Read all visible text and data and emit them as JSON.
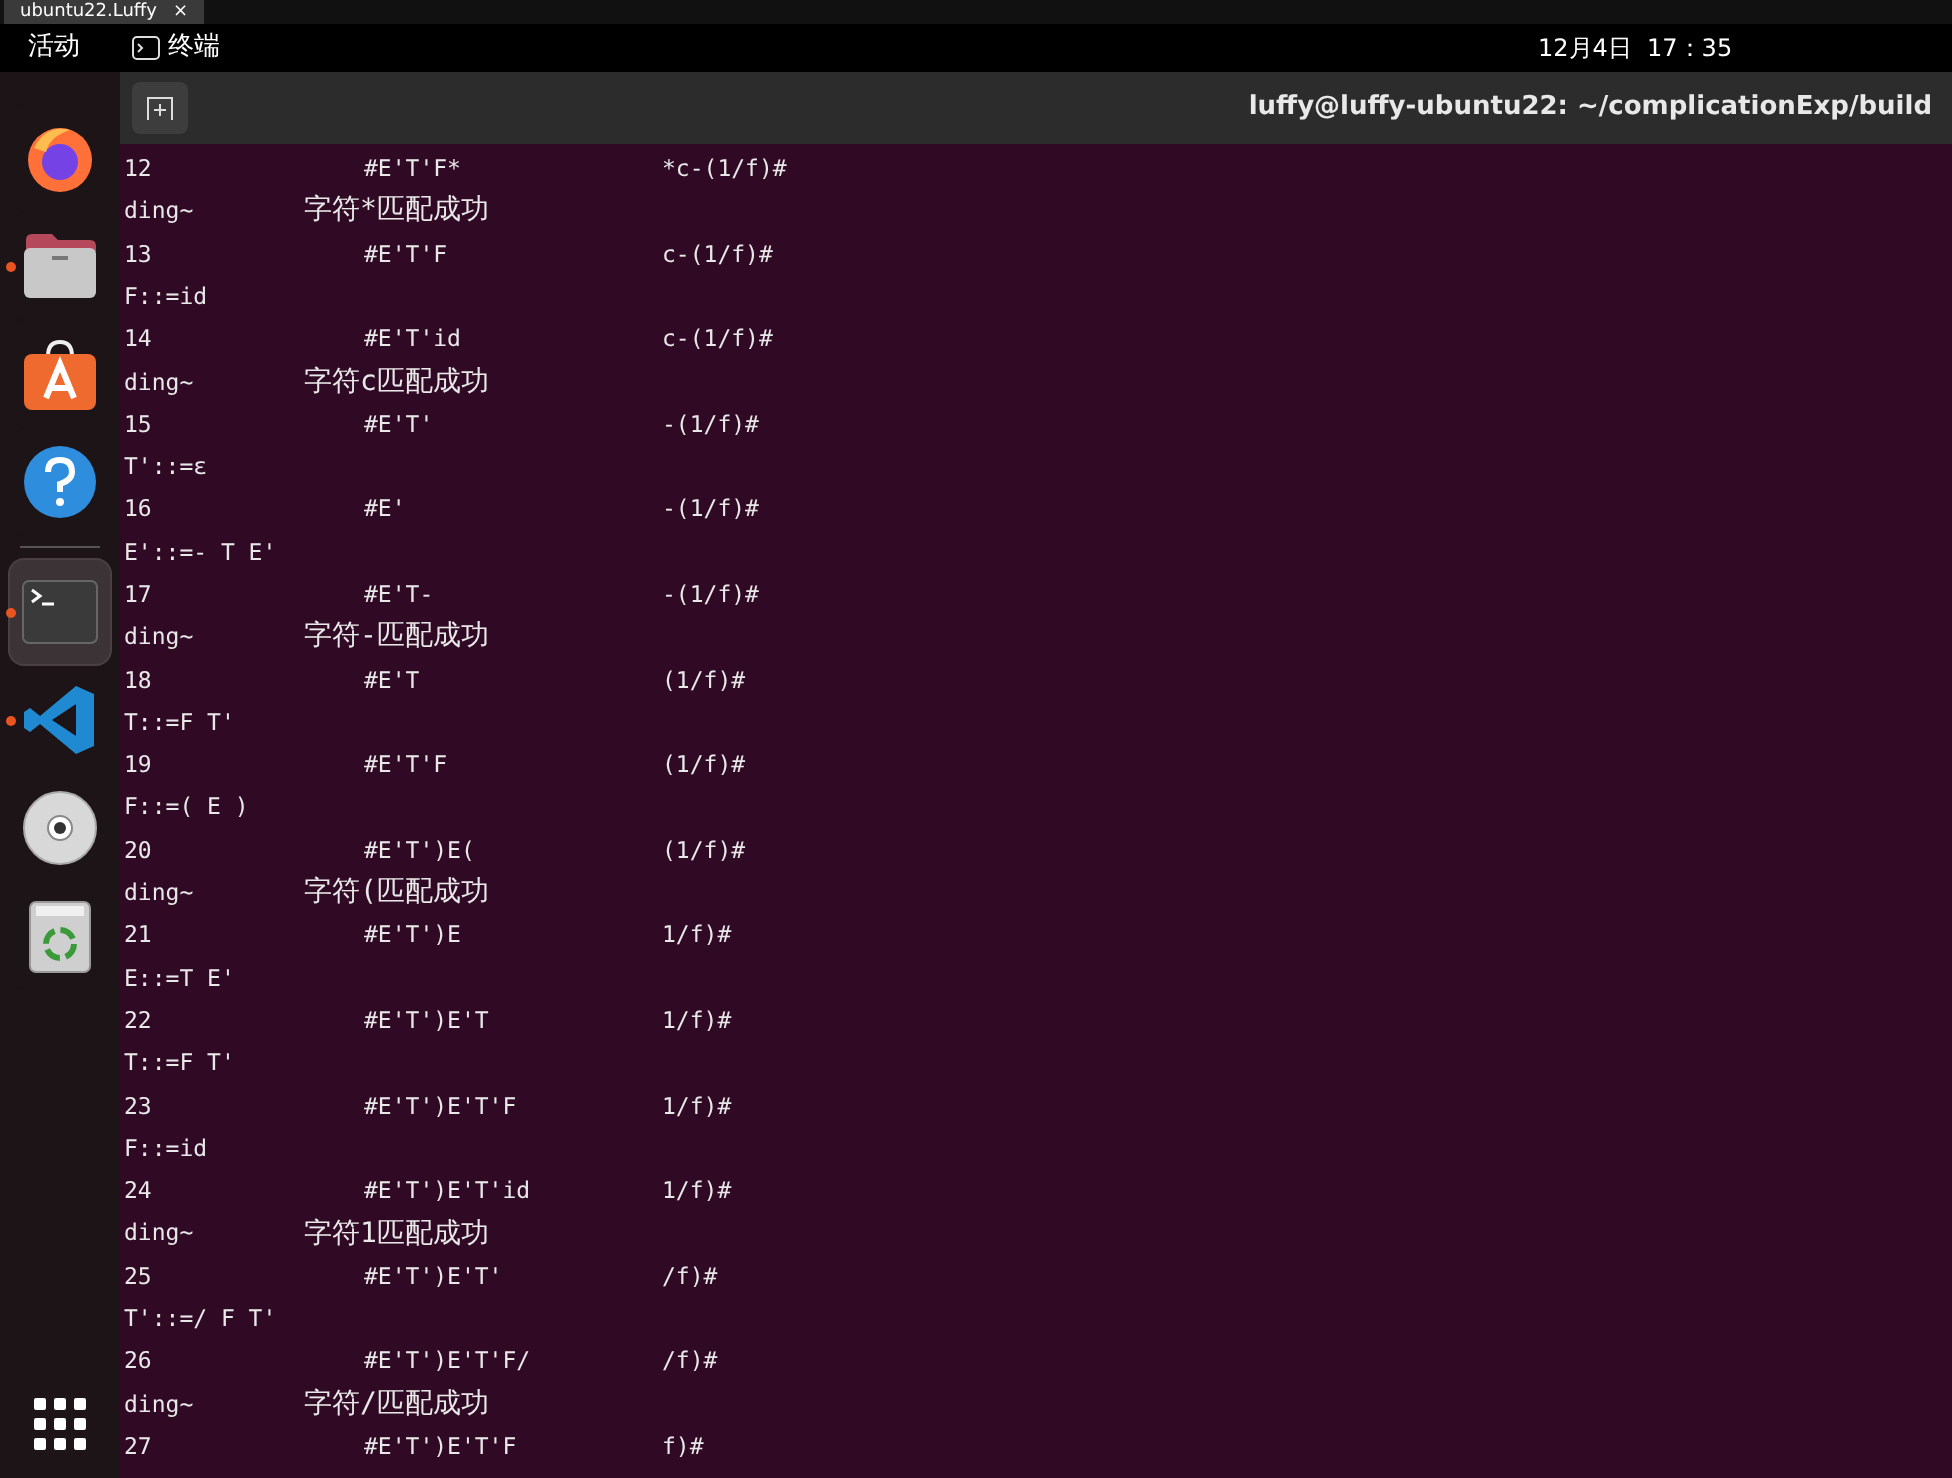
{
  "window_tab": {
    "title": "ubuntu22.Luffy",
    "close": "×"
  },
  "top_bar": {
    "activities": "活动",
    "app_name": "终端",
    "clock": "12月4日  17：35"
  },
  "dock": {
    "items": [
      {
        "kind": "firefox",
        "running": false,
        "selected": false
      },
      {
        "kind": "files",
        "running": true,
        "selected": false
      },
      {
        "kind": "store",
        "running": false,
        "selected": false
      },
      {
        "kind": "help",
        "running": false,
        "selected": false
      },
      {
        "kind": "separator"
      },
      {
        "kind": "terminal",
        "running": true,
        "selected": true
      },
      {
        "kind": "vscode",
        "running": true,
        "selected": false
      },
      {
        "kind": "disc",
        "running": false,
        "selected": false
      },
      {
        "kind": "trash",
        "running": false,
        "selected": false
      }
    ]
  },
  "terminal": {
    "title": "luffy@luffy-ubuntu22: ~/complicationExp/build",
    "lines": [
      {
        "kind": "step",
        "number": "12",
        "stack": "#E'T'F*",
        "input": "*c-(1/f)#"
      },
      {
        "kind": "match",
        "text": "ding~",
        "note": "字符*匹配成功"
      },
      {
        "kind": "step",
        "number": "13",
        "stack": "#E'T'F",
        "input": "c-(1/f)#"
      },
      {
        "kind": "rule",
        "text": "F::=id"
      },
      {
        "kind": "step",
        "number": "14",
        "stack": "#E'T'id",
        "input": "c-(1/f)#"
      },
      {
        "kind": "match",
        "text": "ding~",
        "note": "字符c匹配成功"
      },
      {
        "kind": "step",
        "number": "15",
        "stack": "#E'T'",
        "input": "-(1/f)#"
      },
      {
        "kind": "rule",
        "text": "T'::=ε"
      },
      {
        "kind": "step",
        "number": "16",
        "stack": "#E'",
        "input": "-(1/f)#"
      },
      {
        "kind": "rule",
        "text": "E'::=- T E'"
      },
      {
        "kind": "step",
        "number": "17",
        "stack": "#E'T-",
        "input": "-(1/f)#"
      },
      {
        "kind": "match",
        "text": "ding~",
        "note": "字符-匹配成功"
      },
      {
        "kind": "step",
        "number": "18",
        "stack": "#E'T",
        "input": "(1/f)#"
      },
      {
        "kind": "rule",
        "text": "T::=F T'"
      },
      {
        "kind": "step",
        "number": "19",
        "stack": "#E'T'F",
        "input": "(1/f)#"
      },
      {
        "kind": "rule",
        "text": "F::=( E )"
      },
      {
        "kind": "step",
        "number": "20",
        "stack": "#E'T')E(",
        "input": "(1/f)#"
      },
      {
        "kind": "match",
        "text": "ding~",
        "note": "字符(匹配成功"
      },
      {
        "kind": "step",
        "number": "21",
        "stack": "#E'T')E",
        "input": "1/f)#"
      },
      {
        "kind": "rule",
        "text": "E::=T E'"
      },
      {
        "kind": "step",
        "number": "22",
        "stack": "#E'T')E'T",
        "input": "1/f)#"
      },
      {
        "kind": "rule",
        "text": "T::=F T'"
      },
      {
        "kind": "step",
        "number": "23",
        "stack": "#E'T')E'T'F",
        "input": "1/f)#"
      },
      {
        "kind": "rule",
        "text": "F::=id"
      },
      {
        "kind": "step",
        "number": "24",
        "stack": "#E'T')E'T'id",
        "input": "1/f)#"
      },
      {
        "kind": "match",
        "text": "ding~",
        "note": "字符1匹配成功"
      },
      {
        "kind": "step",
        "number": "25",
        "stack": "#E'T')E'T'",
        "input": "/f)#"
      },
      {
        "kind": "rule",
        "text": "T'::=/ F T'"
      },
      {
        "kind": "step",
        "number": "26",
        "stack": "#E'T')E'T'F/",
        "input": "/f)#"
      },
      {
        "kind": "match",
        "text": "ding~",
        "note": "字符/匹配成功"
      },
      {
        "kind": "step",
        "number": "27",
        "stack": "#E'T')E'T'F",
        "input": "f)#"
      }
    ]
  }
}
